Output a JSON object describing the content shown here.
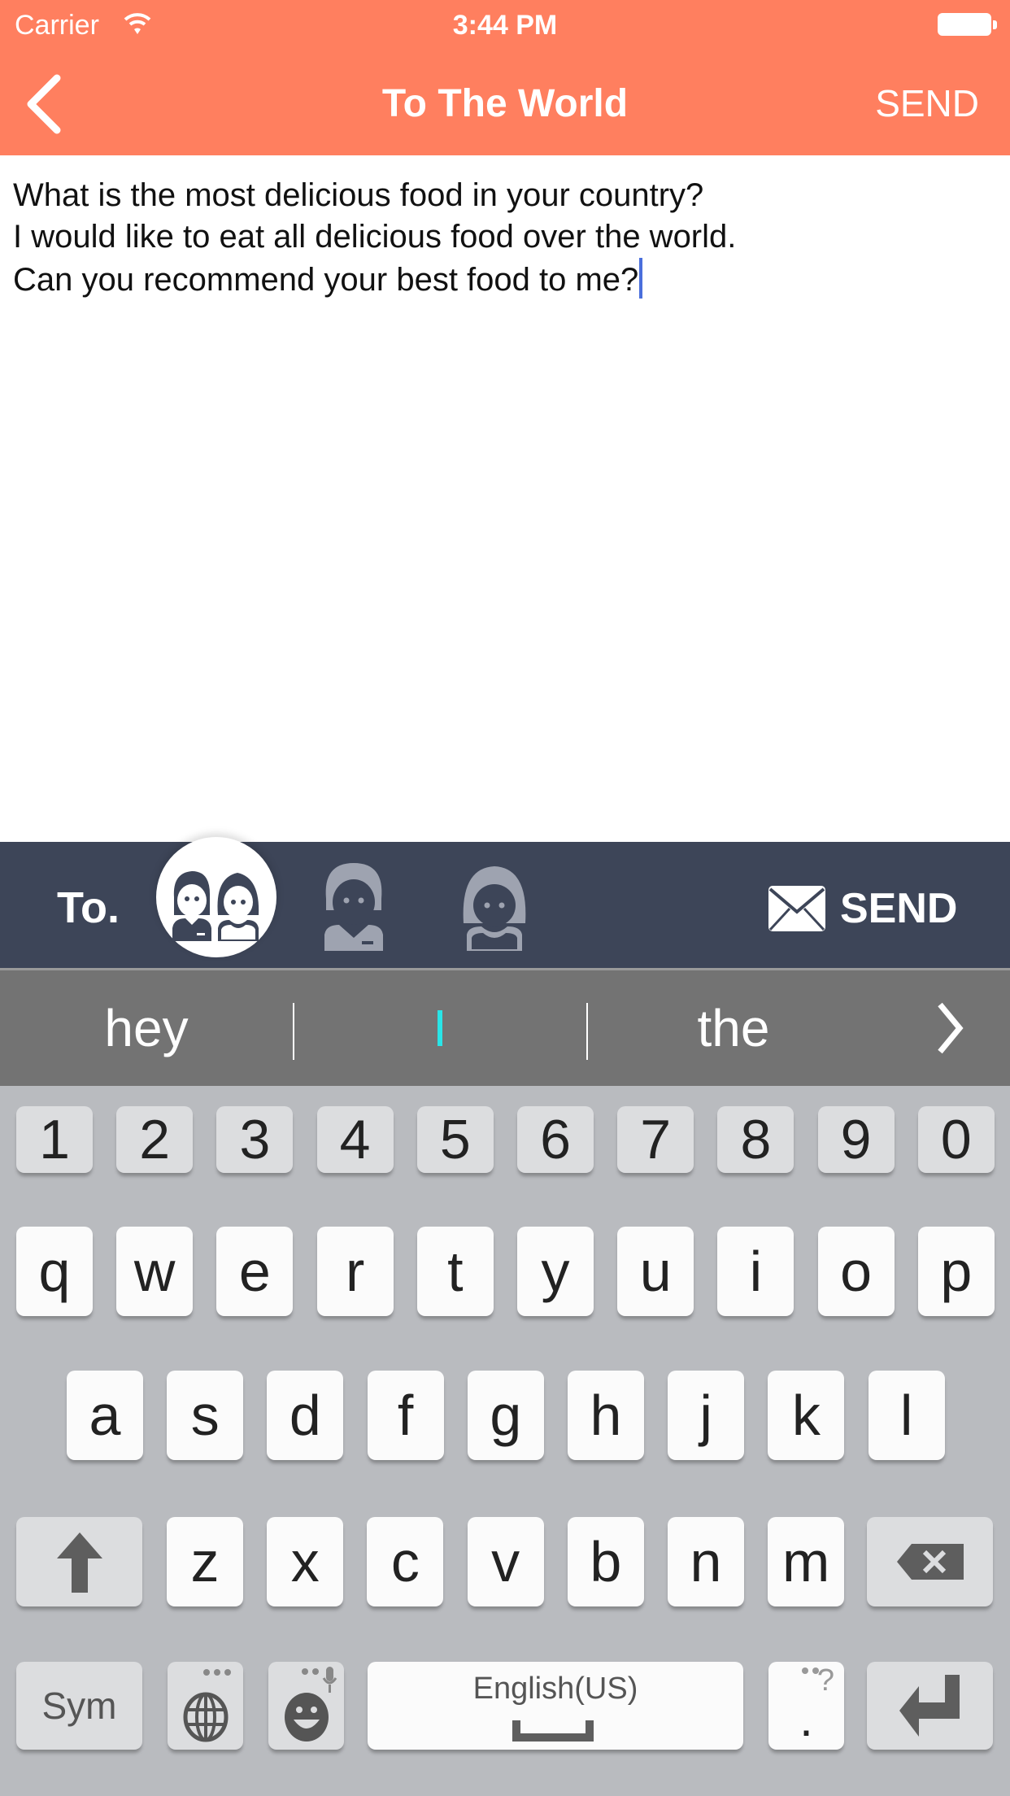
{
  "status_bar": {
    "carrier": "Carrier",
    "time": "3:44 PM",
    "wifi_icon": "wifi-icon",
    "battery_icon": "battery-icon"
  },
  "header": {
    "back_icon": "chevron-left-icon",
    "title": "To The World",
    "send_label": "SEND"
  },
  "compose": {
    "text": "What is the most delicious food in your country?\nI would like to eat all delicious food over the world.\nCan you recommend your best food to me?"
  },
  "recipient_bar": {
    "to_label": "To.",
    "recipients": [
      {
        "name": "everyone",
        "icon": "couple-icon",
        "selected": true
      },
      {
        "name": "male",
        "icon": "male-icon",
        "selected": false
      },
      {
        "name": "female",
        "icon": "female-icon",
        "selected": false
      }
    ],
    "send_label": "SEND",
    "send_icon": "envelope-icon"
  },
  "suggestions": {
    "items": [
      "hey",
      "I",
      "the"
    ],
    "more_icon": "chevron-right-icon"
  },
  "keyboard": {
    "number_row": [
      "1",
      "2",
      "3",
      "4",
      "5",
      "6",
      "7",
      "8",
      "9",
      "0"
    ],
    "row1": [
      "q",
      "w",
      "e",
      "r",
      "t",
      "y",
      "u",
      "i",
      "o",
      "p"
    ],
    "row2": [
      "a",
      "s",
      "d",
      "f",
      "g",
      "h",
      "j",
      "k",
      "l"
    ],
    "row3": [
      "z",
      "x",
      "c",
      "v",
      "b",
      "n",
      "m"
    ],
    "shift_icon": "shift-arrow-icon",
    "backspace_icon": "backspace-icon",
    "sym_label": "Sym",
    "globe_icon": "globe-icon",
    "emoji_icon": "emoji-icon",
    "space_label": "English(US)",
    "period_label": ".",
    "period_hint": "?",
    "enter_icon": "enter-icon"
  },
  "colors": {
    "header": "#FF7F5F",
    "recipient_bar": "#3D4558",
    "suggestion_bar": "#737373",
    "keyboard_bg": "#B9BBBF",
    "suggestion_highlight": "#28E5E8",
    "caret": "#4A6FDC"
  }
}
